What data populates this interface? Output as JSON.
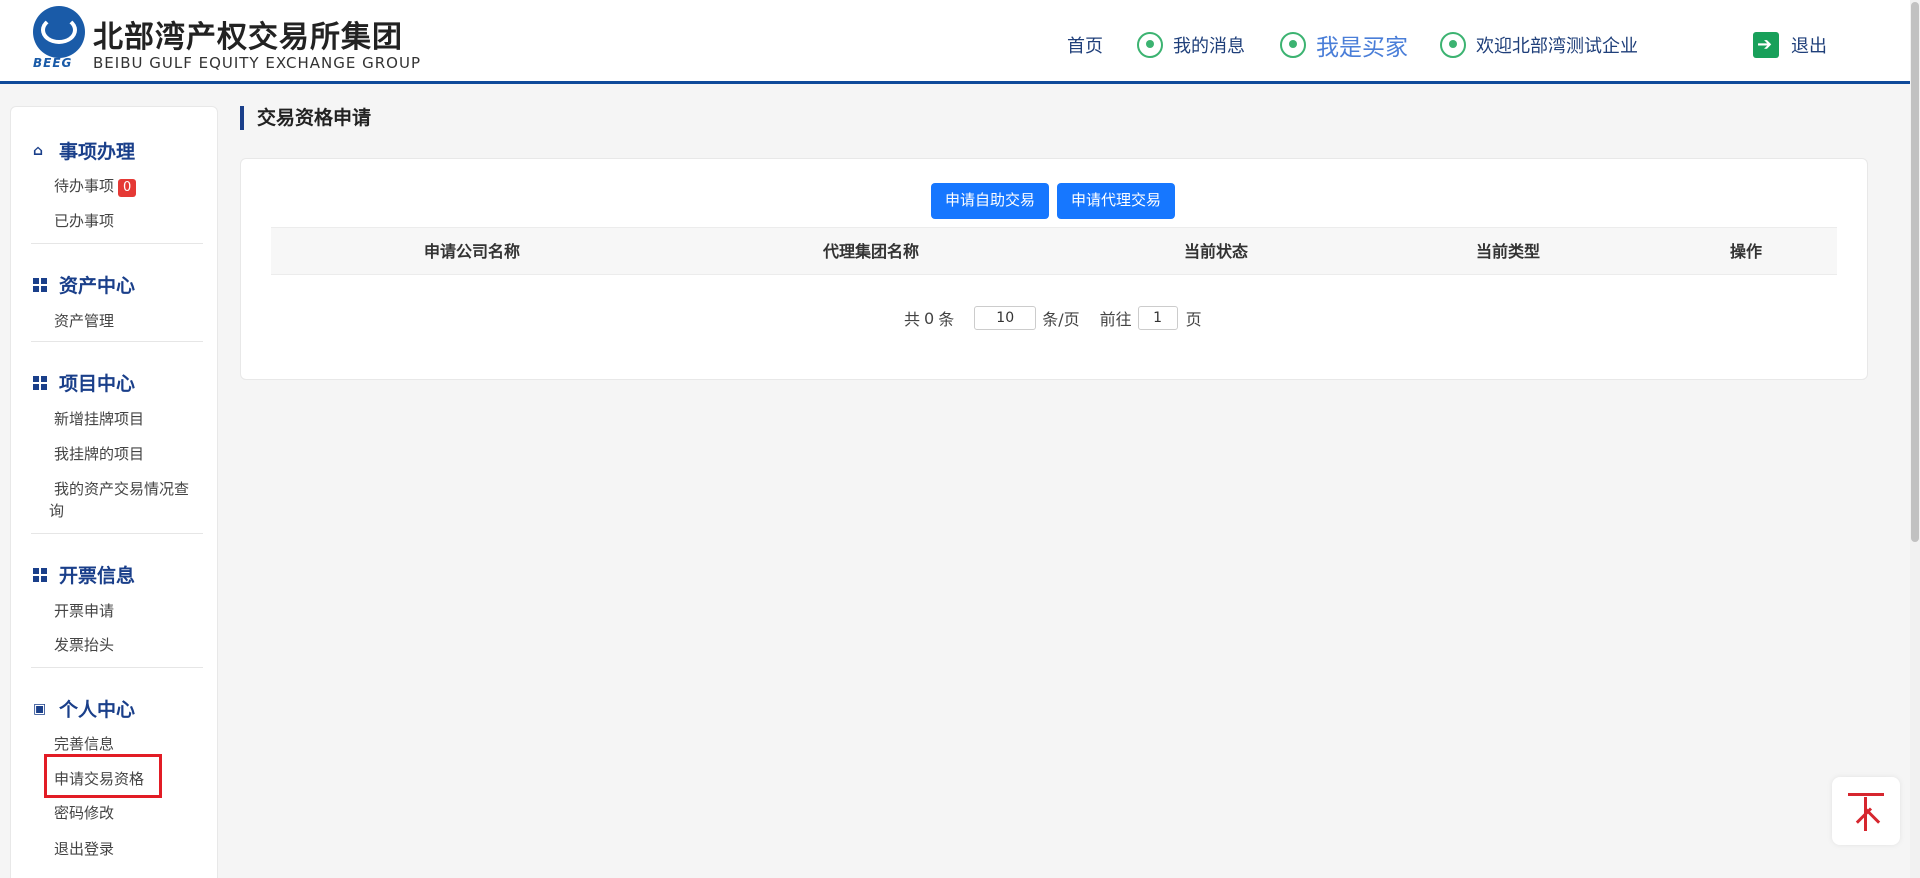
{
  "header": {
    "logo_cn": "北部湾产权交易所集团",
    "logo_en": "BEIBU GULF EQUITY EXCHANGE GROUP",
    "logo_abbr": "BEEG",
    "nav": {
      "home": "首页",
      "messages": "我的消息",
      "buyer": "我是买家",
      "welcome": "欢迎北部湾测试企业",
      "logout": "退出"
    }
  },
  "sidebar": {
    "sections": [
      {
        "title": "事项办理",
        "icon": "home-icon",
        "items": [
          "待办事项",
          "已办事项"
        ]
      },
      {
        "title": "资产中心",
        "icon": "grid-icon",
        "items": [
          "资产管理"
        ]
      },
      {
        "title": "项目中心",
        "icon": "grid-icon",
        "items": [
          "新增挂牌项目",
          "我挂牌的项目",
          "我的资产交易情况查询"
        ]
      },
      {
        "title": "开票信息",
        "icon": "grid-icon",
        "items": [
          "开票申请",
          "发票抬头"
        ]
      },
      {
        "title": "个人中心",
        "icon": "contact-book-icon",
        "items": [
          "完善信息",
          "申请交易资格",
          "密码修改",
          "退出登录"
        ]
      }
    ],
    "todo_badge": "0",
    "project_query_line1": "我的资产交易情况查",
    "project_query_line2": "询"
  },
  "main": {
    "page_title": "交易资格申请",
    "buttons": {
      "self_trade": "申请自助交易",
      "agent_trade": "申请代理交易"
    },
    "table": {
      "columns": [
        "申请公司名称",
        "代理集团名称",
        "当前状态",
        "当前类型",
        "操作"
      ],
      "rows": []
    },
    "pager": {
      "total_prefix": "共",
      "total": "0",
      "total_suffix": "条",
      "page_size": "10",
      "per_page_label": "条/页",
      "goto_label": "前往",
      "page": "1",
      "page_suffix": "页"
    }
  },
  "colors": {
    "brand": "#1a3f8a",
    "primary_button": "#1677ff",
    "badge": "#e53935",
    "highlight": "#e21c25",
    "green_icon": "#3cb371"
  }
}
